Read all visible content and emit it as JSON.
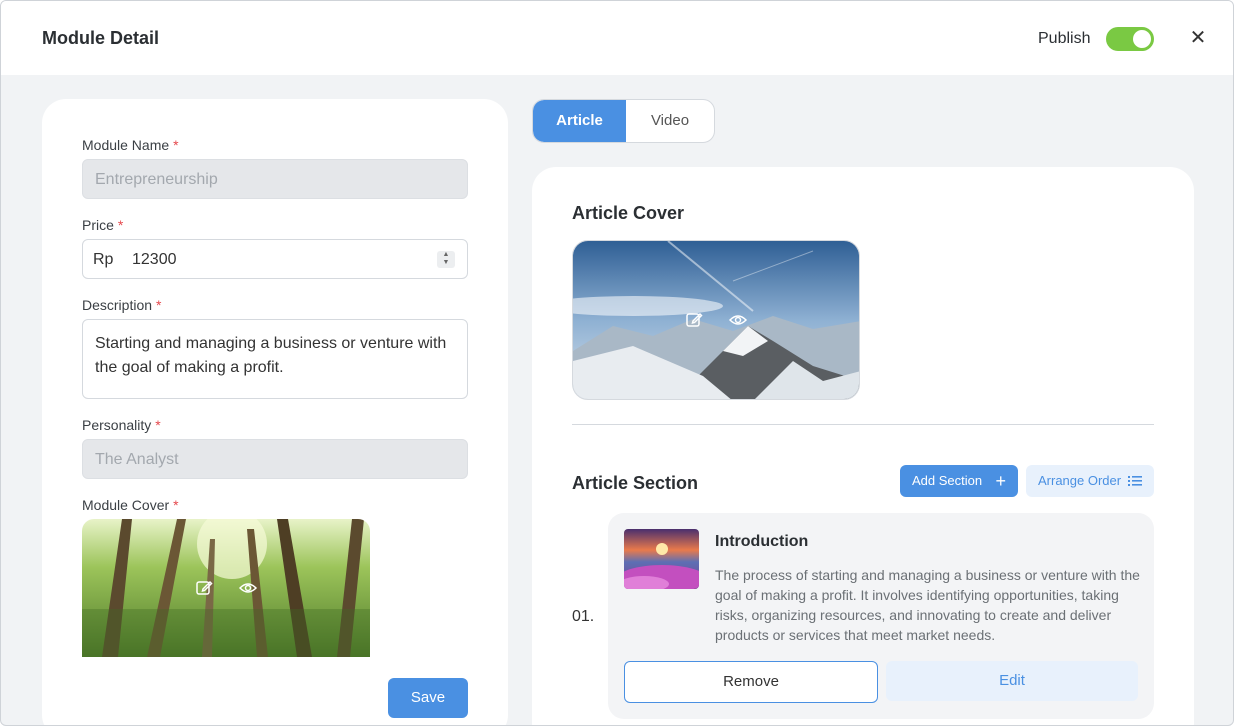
{
  "header": {
    "title": "Module Detail",
    "publish_label": "Publish",
    "publish_on": true
  },
  "left": {
    "module_name": {
      "label": "Module Name",
      "required": "*",
      "value": "Entrepreneurship"
    },
    "price": {
      "label": "Price",
      "required": "*",
      "prefix": "Rp",
      "value": "12300"
    },
    "description": {
      "label": "Description",
      "required": "*",
      "value": "Starting and managing a business or venture with the goal of making a profit."
    },
    "personality": {
      "label": "Personality",
      "required": "*",
      "value": "The Analyst"
    },
    "module_cover": {
      "label": "Module Cover",
      "required": "*"
    },
    "save_label": "Save"
  },
  "tabs": [
    {
      "label": "Article",
      "active": true
    },
    {
      "label": "Video",
      "active": false
    }
  ],
  "right": {
    "article_cover_title": "Article Cover",
    "article_section_title": "Article Section",
    "add_section_label": "Add Section",
    "arrange_order_label": "Arrange Order",
    "sections": [
      {
        "index": "01.",
        "title": "Introduction",
        "description": "The process of starting and managing a business or venture with the goal of making a profit. It involves identifying opportunities, taking risks, organizing resources, and innovating to create and deliver products or services that meet market needs.",
        "remove_label": "Remove",
        "edit_label": "Edit"
      }
    ]
  },
  "colors": {
    "accent": "#4a90e2",
    "toggle_on": "#7ac943",
    "required": "#e5484d"
  },
  "icons": [
    "close-icon",
    "edit-icon",
    "eye-icon",
    "plus-icon",
    "list-icon"
  ]
}
